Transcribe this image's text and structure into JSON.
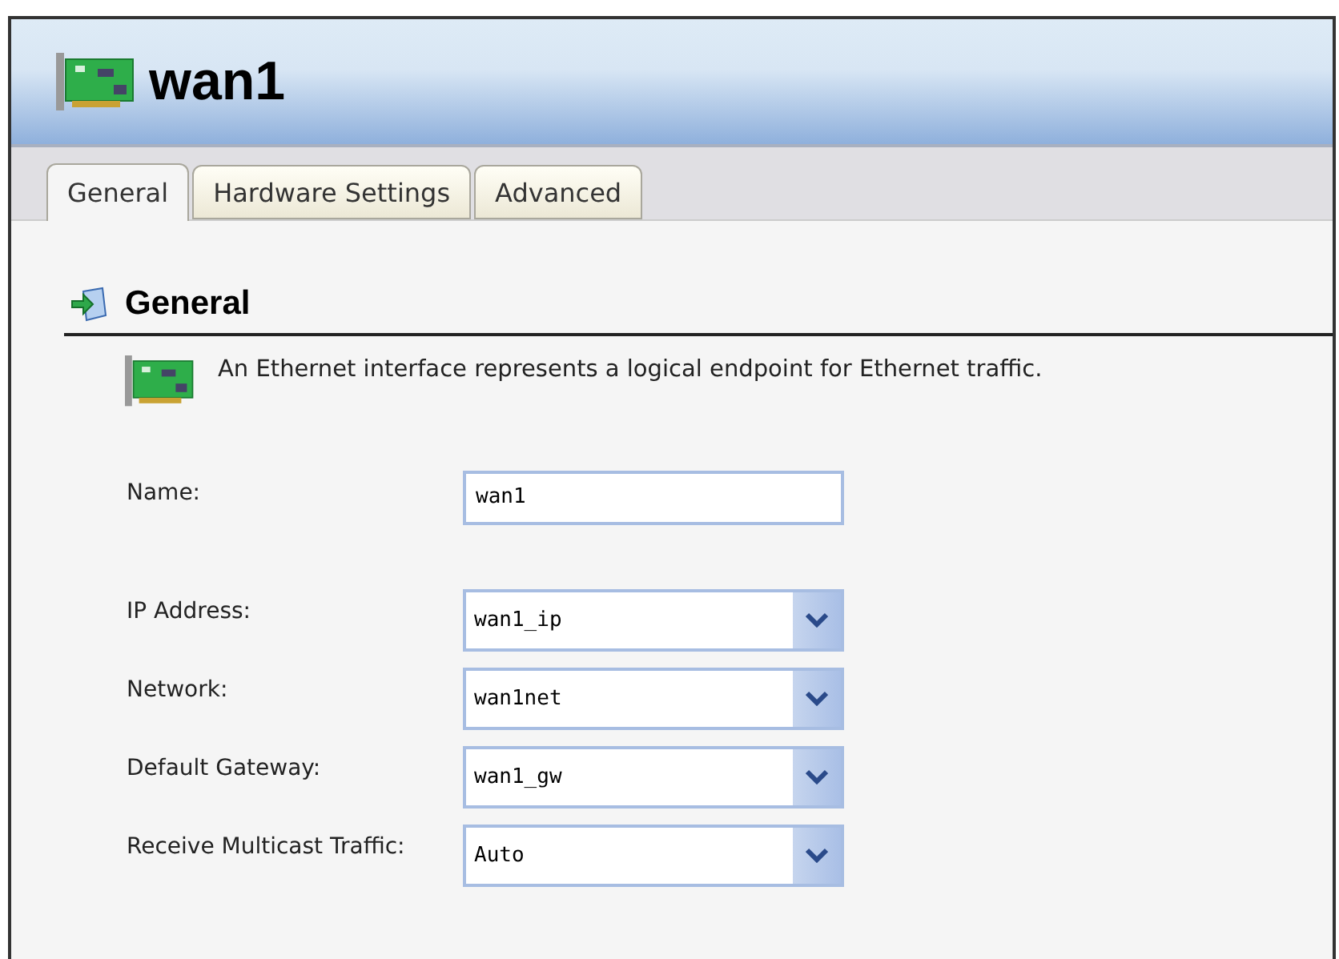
{
  "window": {
    "title": "wan1"
  },
  "tabs": [
    {
      "label": "General",
      "selected": true
    },
    {
      "label": "Hardware Settings",
      "selected": false
    },
    {
      "label": "Advanced",
      "selected": false
    }
  ],
  "section": {
    "title": "General",
    "description": "An Ethernet interface represents a logical endpoint for Ethernet traffic."
  },
  "fields": [
    {
      "label": "Name:",
      "kind": "text",
      "value": "wan1"
    },
    {
      "label": "IP Address:",
      "kind": "select",
      "value": "wan1_ip"
    },
    {
      "label": "Network:",
      "kind": "select",
      "value": "wan1net"
    },
    {
      "label": "Default Gateway:",
      "kind": "select",
      "value": "wan1_gw"
    },
    {
      "label": "Receive Multicast Traffic:",
      "kind": "select",
      "value": "Auto"
    }
  ]
}
